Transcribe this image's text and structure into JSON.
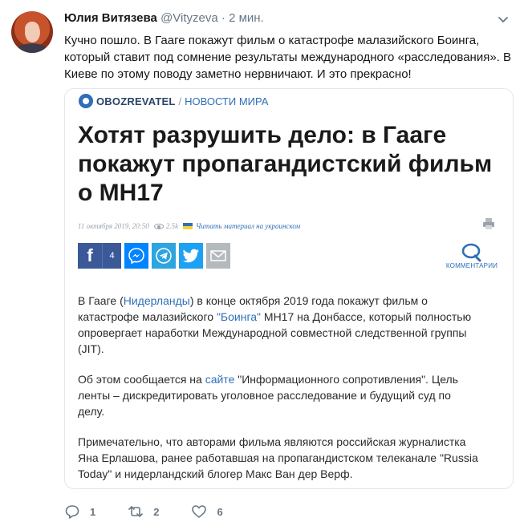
{
  "tweet": {
    "author_name": "Юлия Витязева",
    "handle": "@Vityzeva",
    "separator": "·",
    "time": "2 мин.",
    "text": "Кучно пошло. В Гааге покажут фильм о катастрофе малазийского Боинга, который ставит под сомнение результаты международного «расследования». В Киеве по этому поводу заметно нервничают. И это прекрасно!"
  },
  "card": {
    "brand_name": "OBOZREVATEL",
    "brand_sep": "/",
    "section": "НОВОСТИ МИРА",
    "headline": "Хотят разрушить дело: в Гааге покажут пропагандистский фильм о MH17",
    "date": "11 октября 2019, 20:50",
    "views": "2.5k",
    "translate_link": "Читать материал на украинском",
    "fb_count": "4",
    "comments_label": "КОММЕНТАРИИ",
    "p1": {
      "t1": "В Гааге (",
      "l1": "Нидерланды",
      "t2": ") в конце октября 2019 года покажут фильм о катастрофе малазийского ",
      "l2": "\"Боинга\"",
      "t3": " MH17 на Донбассе, который полностью опровергает наработки Международной совместной следственной группы (JIT)."
    },
    "p2": {
      "t1": "Об этом сообщается на ",
      "l1": "сайте",
      "t2": " \"Информационного сопротивления\". Цель ленты – дискредитировать уголовное расследование и будущий суд по делу."
    },
    "p3": "Примечательно, что авторами фильма являются российская журналистка Яна Ерлашова, ранее работавшая на пропагандистском телеканале \"Russia Today\" и нидерландский блогер Макс Ван дер Верф."
  },
  "actions": {
    "replies": "1",
    "retweets": "2",
    "likes": "6"
  },
  "colors": {
    "link": "#2e6fb7",
    "facebook": "#3b5998",
    "twitter": "#1da1f2",
    "telegram": "#2ca5e0",
    "messenger": "#0084ff"
  },
  "icons": [
    "chevron-down-icon",
    "print-icon",
    "facebook-icon",
    "messenger-icon",
    "telegram-icon",
    "twitter-icon",
    "mail-icon",
    "comments-icon",
    "reply-icon",
    "retweet-icon",
    "like-icon",
    "eye-icon",
    "ukraine-flag-icon"
  ]
}
